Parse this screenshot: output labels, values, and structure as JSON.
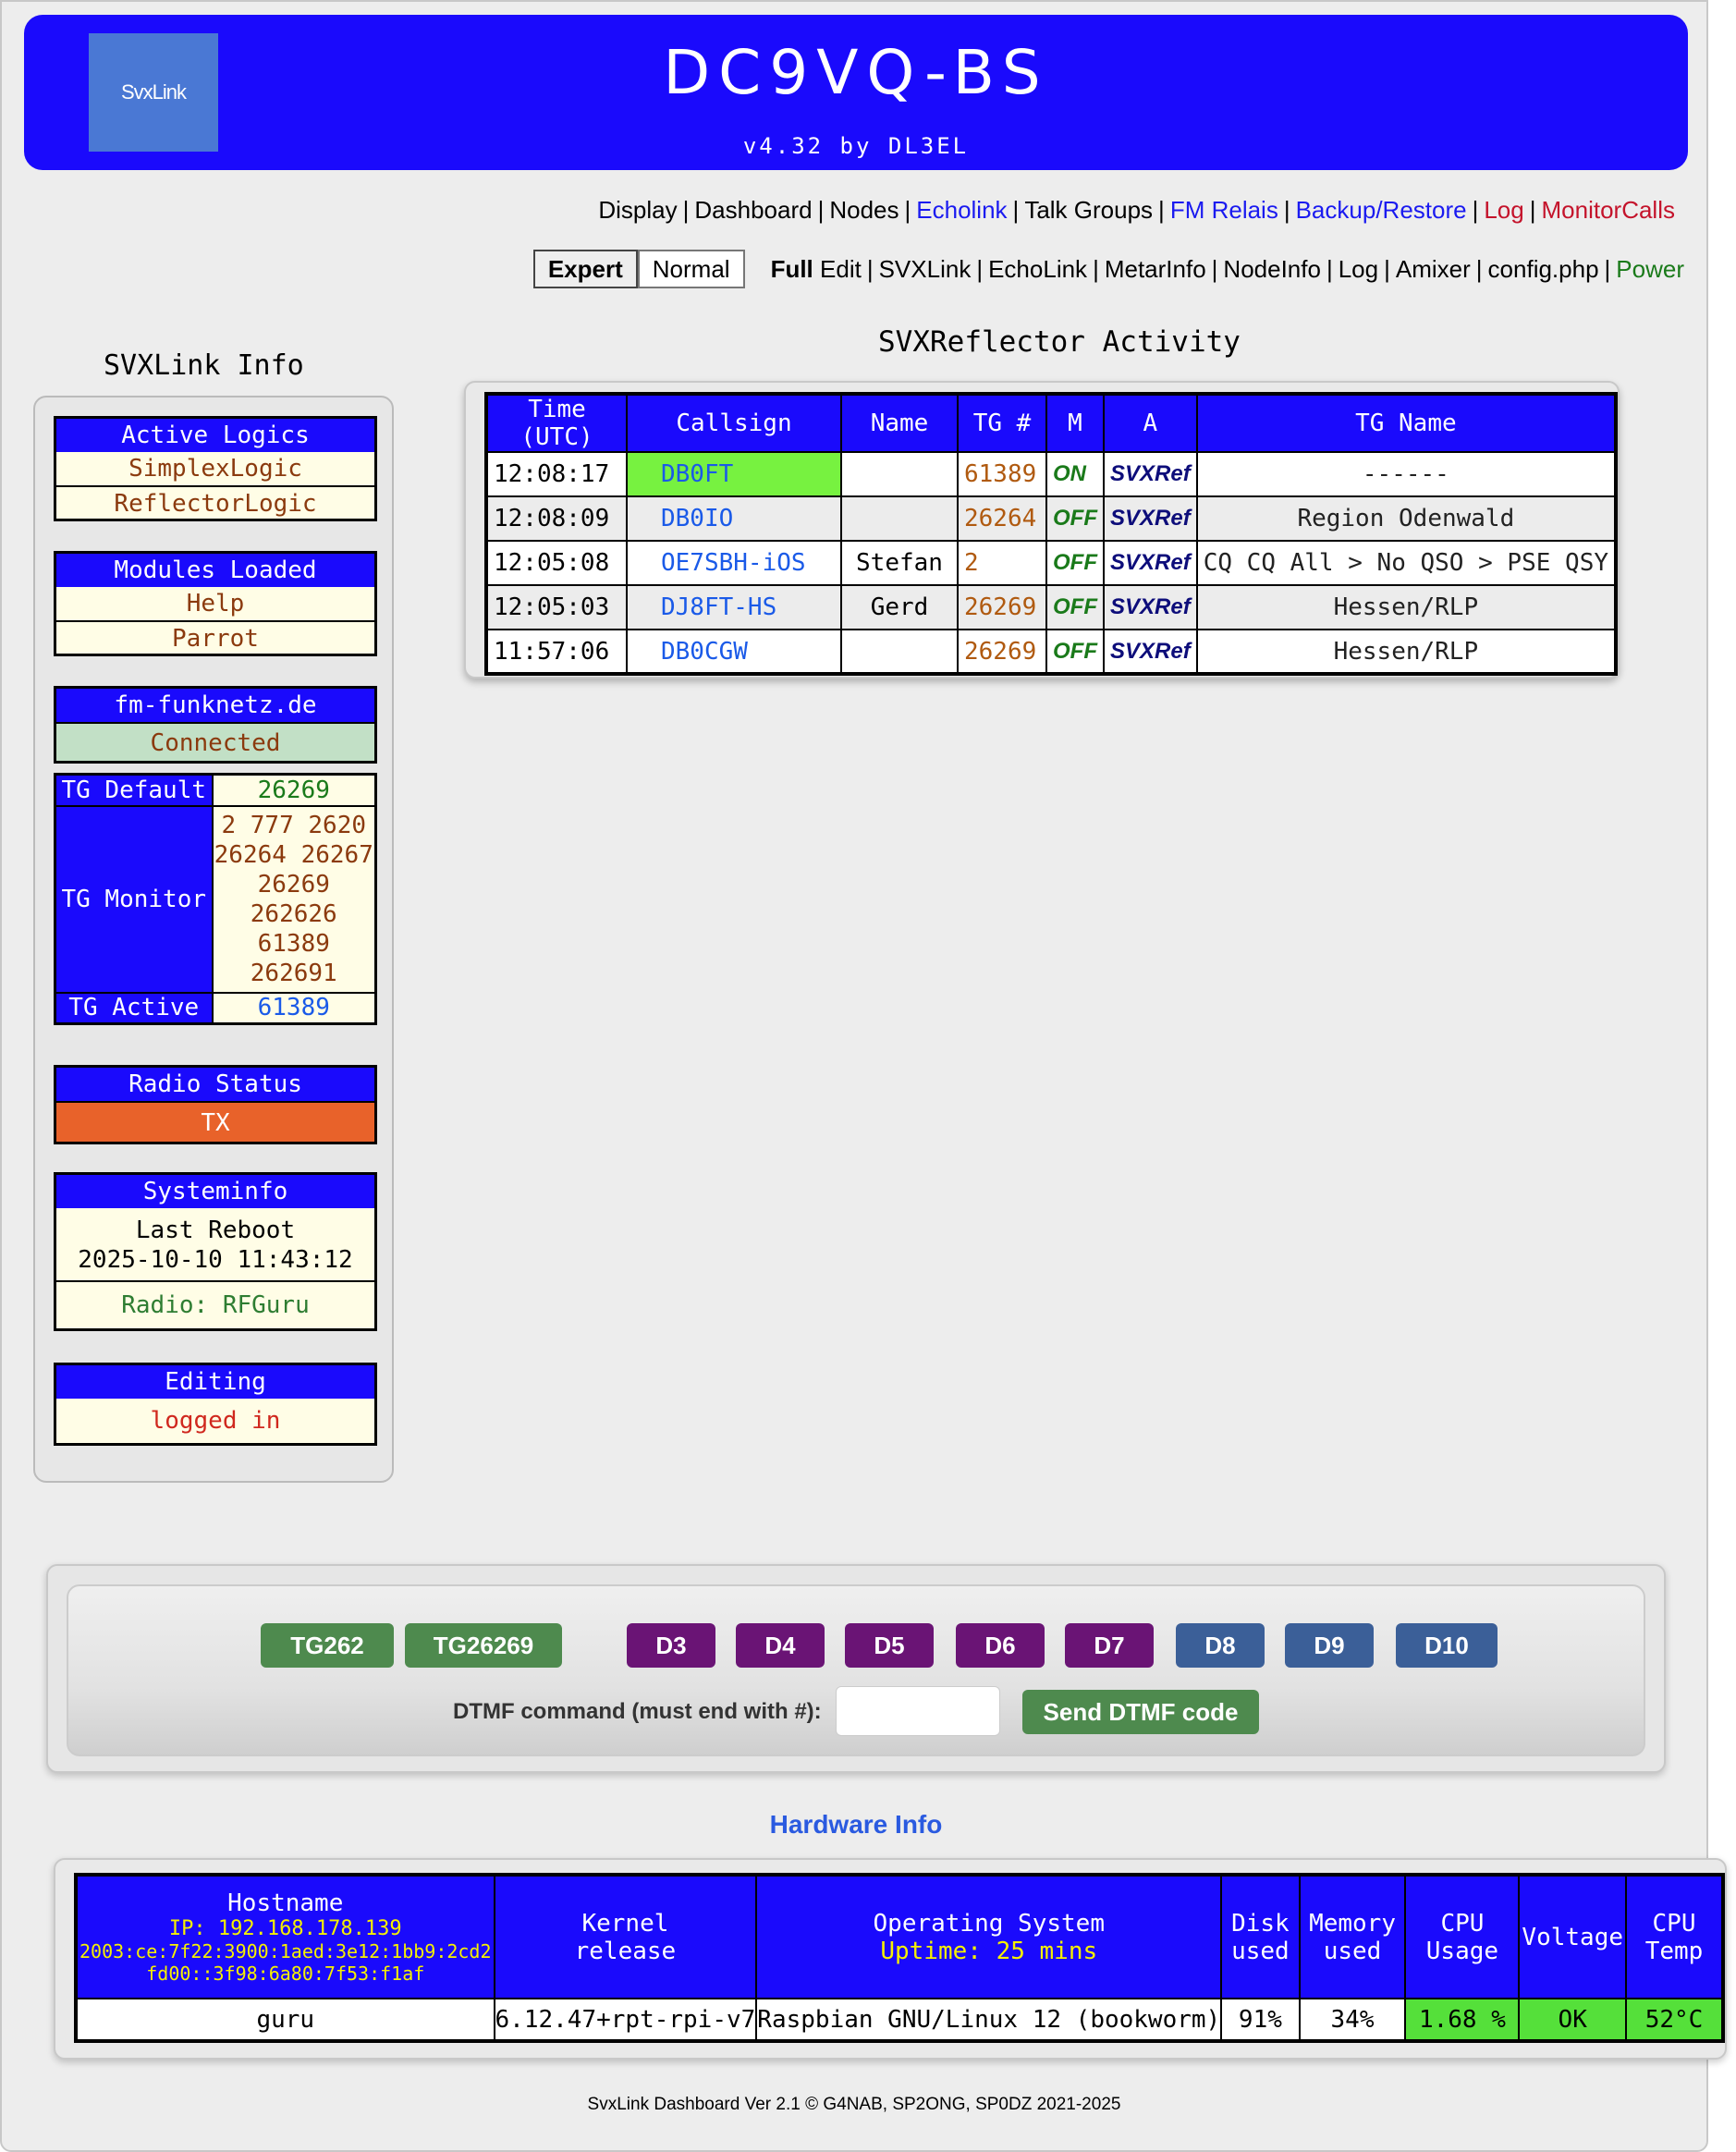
{
  "header": {
    "logo_text": "SvxLink",
    "title": "DC9VQ-BS",
    "subtitle": "v4.32 by DL3EL"
  },
  "nav1": [
    {
      "label": "Display",
      "color": "#000000"
    },
    {
      "label": "Dashboard",
      "color": "#000000"
    },
    {
      "label": "Nodes",
      "color": "#000000"
    },
    {
      "label": "Echolink",
      "color": "#1a1af0"
    },
    {
      "label": "Talk Groups",
      "color": "#000000"
    },
    {
      "label": "FM Relais",
      "color": "#1a1af0"
    },
    {
      "label": "Backup/Restore",
      "color": "#1a1af0"
    },
    {
      "label": "Log",
      "color": "#c4132b"
    },
    {
      "label": "MonitorCalls",
      "color": "#c4132b"
    }
  ],
  "nav2": {
    "mode_expert": "Expert",
    "mode_normal": "Normal",
    "full_label": "Full",
    "edit_label": "Edit",
    "links": [
      {
        "label": "SVXLink",
        "color": "#000000"
      },
      {
        "label": "EchoLink",
        "color": "#000000"
      },
      {
        "label": "MetarInfo",
        "color": "#000000"
      },
      {
        "label": "NodeInfo",
        "color": "#000000"
      },
      {
        "label": "Log",
        "color": "#000000"
      },
      {
        "label": "Amixer",
        "color": "#000000"
      },
      {
        "label": "config.php",
        "color": "#000000"
      },
      {
        "label": "Power",
        "color": "#1a7a1a"
      }
    ]
  },
  "sidebar": {
    "title": "SVXLink Info",
    "active_logics": {
      "header": "Active Logics",
      "items": [
        "SimplexLogic",
        "ReflectorLogic"
      ]
    },
    "modules": {
      "header": "Modules Loaded",
      "items": [
        "Help",
        "Parrot"
      ]
    },
    "network": {
      "header": "fm-funknetz.de",
      "status": "Connected"
    },
    "tg": {
      "default_label": "TG Default",
      "default_value": "26269",
      "monitor_label": "TG Monitor",
      "monitor_lines": [
        "2 777 2620",
        "26264 26267",
        "26269",
        "262626",
        "61389",
        "262691"
      ],
      "active_label": "TG Active",
      "active_value": "61389"
    },
    "radio": {
      "header": "Radio Status",
      "status": "TX",
      "status_color": "#e8622a"
    },
    "sysinfo": {
      "header": "Systeminfo",
      "reboot_label": "Last Reboot",
      "reboot_time": "2025-10-10 11:43:12",
      "radio": "Radio: RFGuru"
    },
    "editing": {
      "header": "Editing",
      "status": "logged in"
    }
  },
  "activity": {
    "title": "SVXReflector Activity",
    "columns": [
      "Time (UTC)",
      "Callsign",
      "Name",
      "TG #",
      "M",
      "A",
      "TG Name"
    ],
    "rows": [
      {
        "time": "12:08:17",
        "callsign": "DB0FT",
        "name": "",
        "tg": "61389",
        "m": "ON",
        "a": "SVXRef",
        "tgname": "------",
        "highlight": "#77f240"
      },
      {
        "time": "12:08:09",
        "callsign": "DB0IO",
        "name": "",
        "tg": "26264",
        "m": "OFF",
        "a": "SVXRef",
        "tgname": "Region Odenwald",
        "highlight": ""
      },
      {
        "time": "12:05:08",
        "callsign": "OE7SBH-iOS",
        "name": "Stefan",
        "tg": "2",
        "m": "OFF",
        "a": "SVXRef",
        "tgname": "CQ CQ All > No QSO > PSE QSY",
        "highlight": ""
      },
      {
        "time": "12:05:03",
        "callsign": "DJ8FT-HS",
        "name": "Gerd",
        "tg": "26269",
        "m": "OFF",
        "a": "SVXRef",
        "tgname": "Hessen/RLP",
        "highlight": ""
      },
      {
        "time": "11:57:06",
        "callsign": "DB0CGW",
        "name": "",
        "tg": "26269",
        "m": "OFF",
        "a": "SVXRef",
        "tgname": "Hessen/RLP",
        "highlight": ""
      }
    ]
  },
  "dtmf": {
    "buttons": [
      {
        "label": "TG262",
        "color": "#4e8a4e"
      },
      {
        "label": "TG26269",
        "color": "#4e8a4e"
      },
      {
        "label": "D3",
        "color": "#6a1475"
      },
      {
        "label": "D4",
        "color": "#6a1475"
      },
      {
        "label": "D5",
        "color": "#6a1475"
      },
      {
        "label": "D6",
        "color": "#6a1475"
      },
      {
        "label": "D7",
        "color": "#6a1475"
      },
      {
        "label": "D8",
        "color": "#3b5f98"
      },
      {
        "label": "D9",
        "color": "#3b5f98"
      },
      {
        "label": "D10",
        "color": "#3b5f98"
      }
    ],
    "label": "DTMF command (must end with #):",
    "input_value": "",
    "send_label": "Send DTMF code"
  },
  "hardware": {
    "title": "Hardware Info",
    "hostname_label": "Hostname",
    "ip_line": "IP: 192.168.178.139",
    "ipv6_1": "2003:ce:7f22:3900:1aed:3e12:1bb9:2cd2",
    "ipv6_2": "fd00::3f98:6a80:7f53:f1af",
    "kernel_label": [
      "Kernel",
      "release"
    ],
    "os_label": "Operating System",
    "uptime": "Uptime: 25 mins",
    "disk_label": [
      "Disk",
      "used"
    ],
    "mem_label": [
      "Memory",
      "used"
    ],
    "cpu_label": "CPU Usage",
    "volt_label": "Voltage",
    "temp_label": "CPU Temp",
    "values": {
      "hostname": "guru",
      "kernel": "6.12.47+rpt-rpi-v7",
      "os": "Raspbian GNU/Linux 12 (bookworm)",
      "disk": "91%",
      "memory": "34%",
      "cpu": "1.68 %",
      "voltage": "OK",
      "temp": "52°C"
    }
  },
  "footer": "SvxLink Dashboard Ver 2.1 © G4NAB, SP2ONG, SP0DZ 2021-2025"
}
